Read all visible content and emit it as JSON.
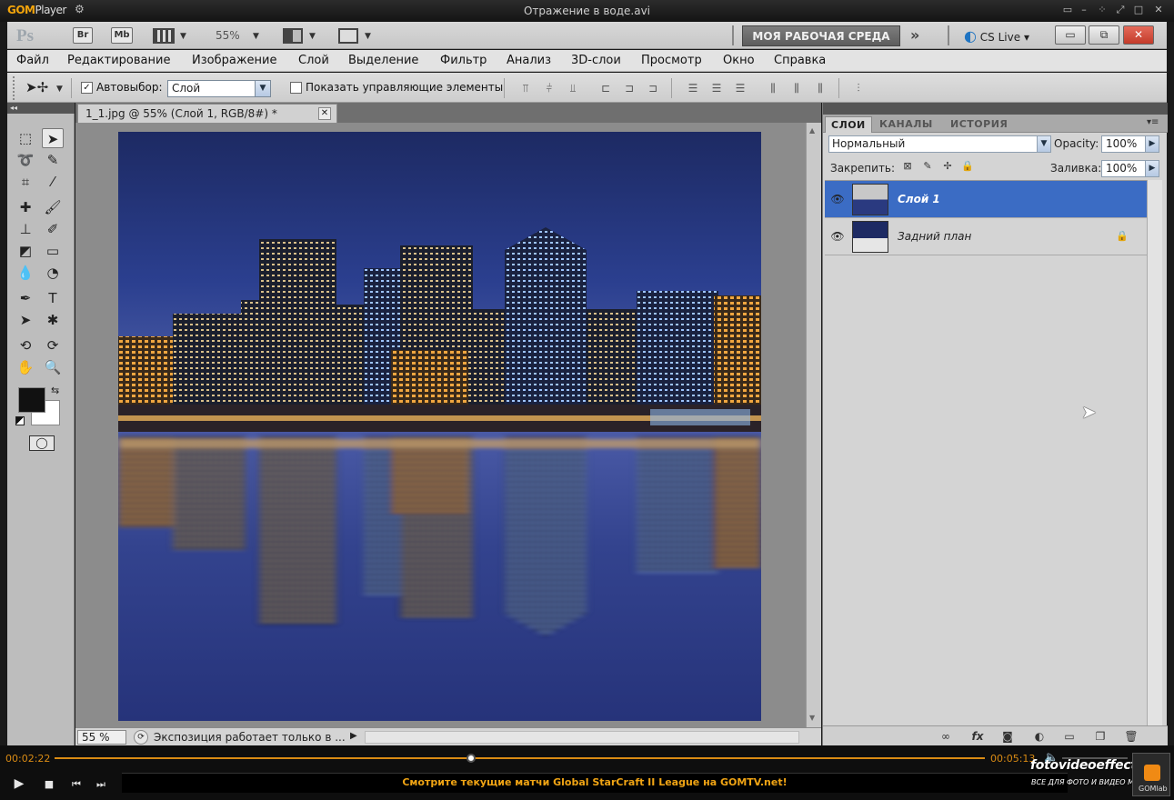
{
  "player": {
    "logo_main": "GOM",
    "logo_sub": "Player",
    "file_title": "Отражение в воде.avi",
    "time_current": "00:02:22",
    "time_total": "00:05:13",
    "progress_fraction": 0.45,
    "ticker": "Смотрите текущие матчи Global StarCraft II League на GOMTV.net!",
    "gomlab": "GOMlab"
  },
  "watermark": {
    "title": "fotovideoeffect.com",
    "subtitle": "ВСЕ ДЛЯ ФОТО И ВИДЕО МОНТАЖА!"
  },
  "appbar": {
    "logo": "Ps",
    "br": "Br",
    "mb": "Mb",
    "zoom": "55%",
    "workspace": "МОЯ РАБОЧАЯ СРЕДА",
    "cs_live": "CS Live"
  },
  "menu": [
    "Файл",
    "Редактирование",
    "Изображение",
    "Слой",
    "Выделение",
    "Фильтр",
    "Анализ",
    "3D-слои",
    "Просмотр",
    "Окно",
    "Справка"
  ],
  "options": {
    "autoselect_label": "Автовыбор:",
    "autoselect_value": "Слой",
    "show_controls_label": "Показать управляющие элементы"
  },
  "document": {
    "tab_title": "1_1.jpg @ 55% (Слой 1, RGB/8#) *",
    "zoom": "55 %",
    "status": "Экспозиция работает только в ..."
  },
  "panels": {
    "tabs": [
      "СЛОИ",
      "КАНАЛЫ",
      "ИСТОРИЯ"
    ],
    "blend_mode": "Нормальный",
    "opacity_label": "Opacity:",
    "opacity": "100%",
    "lock_label": "Закрепить:",
    "fill_label": "Заливка:",
    "fill": "100%",
    "layers": [
      {
        "name": "Слой 1",
        "selected": true
      },
      {
        "name": "Задний план",
        "selected": false
      }
    ]
  }
}
